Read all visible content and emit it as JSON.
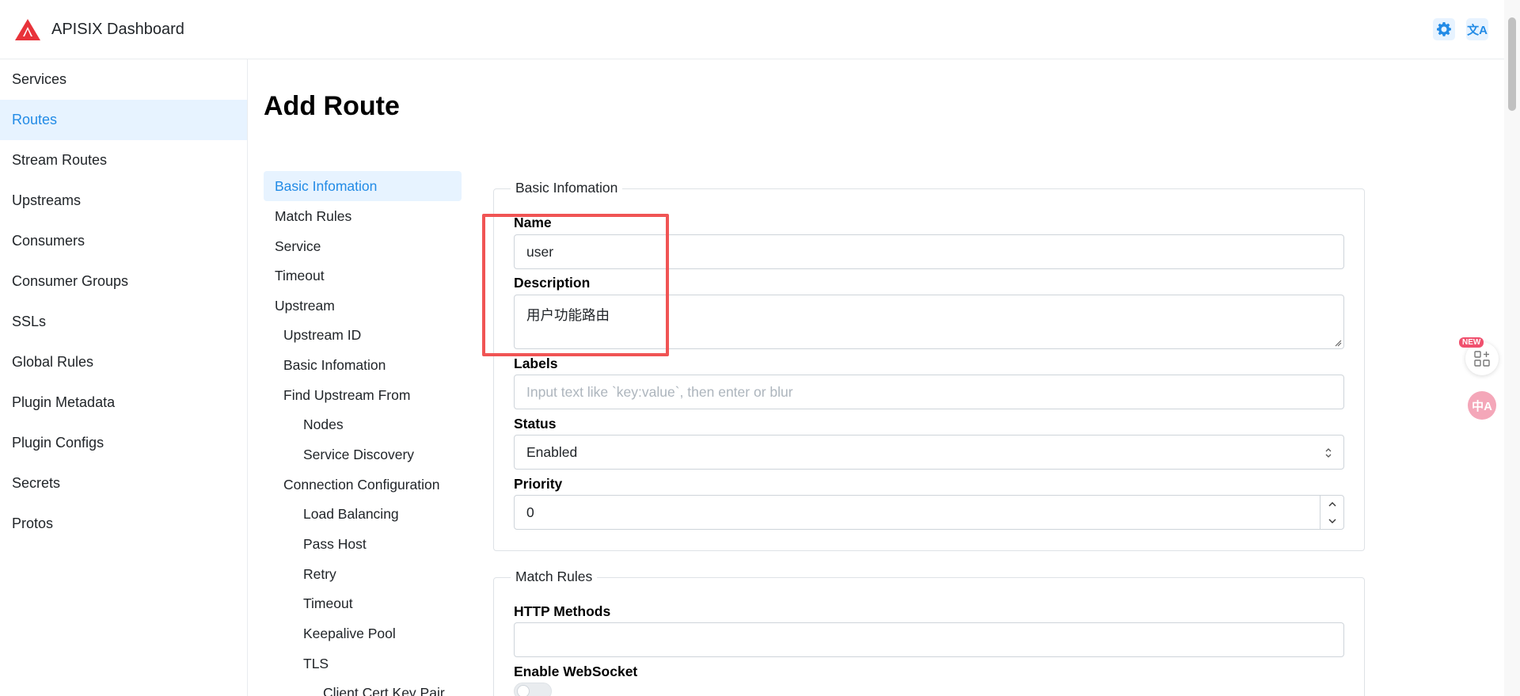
{
  "header": {
    "app_title": "APISIX Dashboard",
    "lang_label": "文A"
  },
  "sidebar": {
    "items": [
      {
        "label": "Services",
        "active": false
      },
      {
        "label": "Routes",
        "active": true
      },
      {
        "label": "Stream Routes",
        "active": false
      },
      {
        "label": "Upstreams",
        "active": false
      },
      {
        "label": "Consumers",
        "active": false
      },
      {
        "label": "Consumer Groups",
        "active": false
      },
      {
        "label": "SSLs",
        "active": false
      },
      {
        "label": "Global Rules",
        "active": false
      },
      {
        "label": "Plugin Metadata",
        "active": false
      },
      {
        "label": "Plugin Configs",
        "active": false
      },
      {
        "label": "Secrets",
        "active": false
      },
      {
        "label": "Protos",
        "active": false
      }
    ]
  },
  "page": {
    "title": "Add Route"
  },
  "toc": {
    "items": [
      {
        "label": "Basic Infomation",
        "level": 0,
        "active": true
      },
      {
        "label": "Match Rules",
        "level": 0
      },
      {
        "label": "Service",
        "level": 0
      },
      {
        "label": "Timeout",
        "level": 0
      },
      {
        "label": "Upstream",
        "level": 0
      },
      {
        "label": "Upstream ID",
        "level": 1
      },
      {
        "label": "Basic Infomation",
        "level": 1
      },
      {
        "label": "Find Upstream From",
        "level": 1
      },
      {
        "label": "Nodes",
        "level": 2
      },
      {
        "label": "Service Discovery",
        "level": 2
      },
      {
        "label": "Connection Configuration",
        "level": 1
      },
      {
        "label": "Load Balancing",
        "level": 2
      },
      {
        "label": "Pass Host",
        "level": 2
      },
      {
        "label": "Retry",
        "level": 2
      },
      {
        "label": "Timeout",
        "level": 2
      },
      {
        "label": "Keepalive Pool",
        "level": 2
      },
      {
        "label": "TLS",
        "level": 2
      },
      {
        "label": "Client Cert Key Pair",
        "level": 3
      }
    ]
  },
  "basic_info": {
    "legend": "Basic Infomation",
    "name_label": "Name",
    "name_value": "user",
    "description_label": "Description",
    "description_value": "用户功能路由",
    "labels_label": "Labels",
    "labels_placeholder": "Input text like `key:value`, then enter or blur",
    "status_label": "Status",
    "status_value": "Enabled",
    "priority_label": "Priority",
    "priority_value": "0"
  },
  "match_rules": {
    "legend": "Match Rules",
    "http_methods_label": "HTTP Methods",
    "websocket_label": "Enable WebSocket",
    "websocket_enabled": false
  },
  "floating": {
    "new_badge": "NEW",
    "translate_label": "中A"
  },
  "colors": {
    "accent": "#228be6",
    "active_bg": "#e7f3ff",
    "highlight": "#f05454",
    "logo_red": "#e8333a"
  }
}
